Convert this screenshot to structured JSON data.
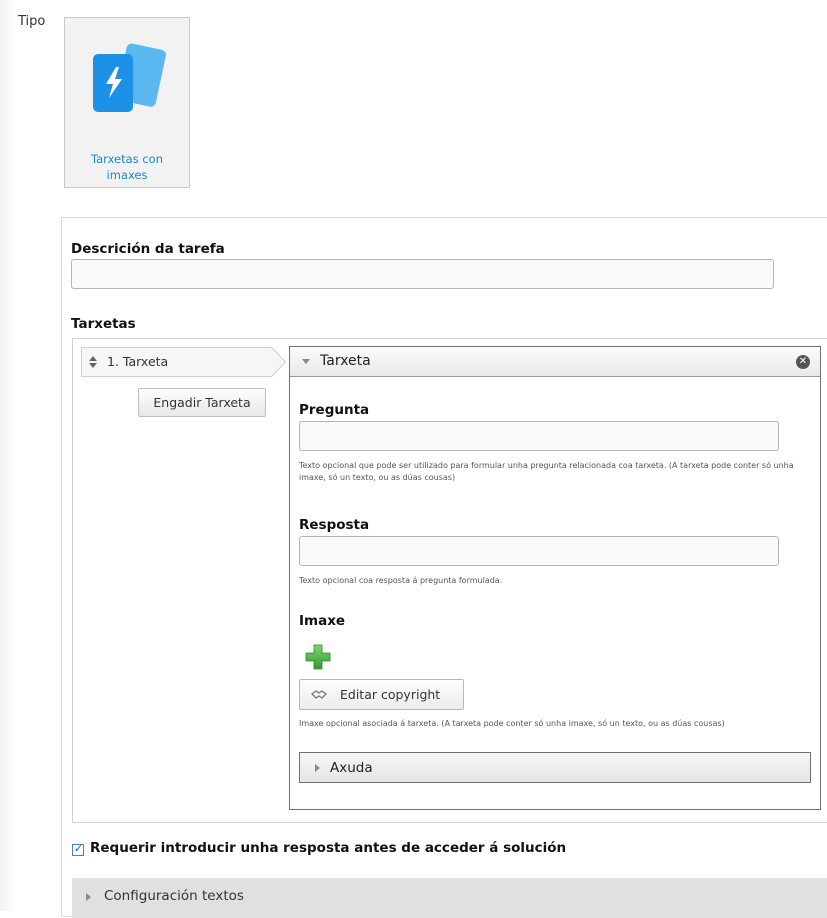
{
  "type_section": {
    "label": "Tipo",
    "selected_type": {
      "label_line1": "Tarxetas con",
      "label_line2": "imaxes",
      "icon": "flashcards-icon"
    }
  },
  "task_description": {
    "title": "Descrición da tarefa",
    "value": ""
  },
  "cards_section": {
    "title": "Tarxetas",
    "items": [
      {
        "label": "1. Tarxeta"
      }
    ],
    "add_button_label": "Engadir Tarxeta"
  },
  "card_editor": {
    "title": "Tarxeta",
    "question": {
      "title": "Pregunta",
      "value": "",
      "description": "Texto opcional que pode ser utilizado para formular unha pregunta relacionada coa tarxeta. (A tarxeta pode conter só unha imaxe, só un texto, ou as dúas cousas)"
    },
    "answer": {
      "title": "Resposta",
      "value": "",
      "description": "Texto opcional coa resposta á pregunta formulada."
    },
    "image": {
      "title": "Imaxe",
      "edit_copyright_label": "Editar copyright",
      "description": "Imaxe opcional asociada á tarxeta. (A tarxeta pode conter só unha imaxe, só un texto, ou as dúas cousas)"
    },
    "help_label": "Axuda"
  },
  "require_answer": {
    "checked": true,
    "label": "Requerir introducir unha resposta antes de acceder á solución"
  },
  "text_settings": {
    "label": "Configuración textos"
  },
  "colors": {
    "accent": "#1a8ac9",
    "add_icon": "#3fa63b"
  }
}
